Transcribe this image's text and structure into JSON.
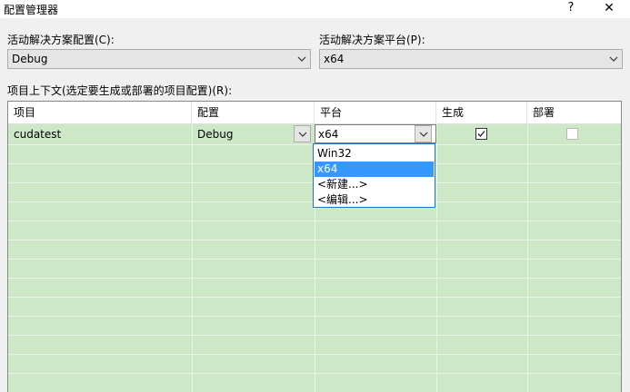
{
  "window": {
    "title": "配置管理器",
    "help_label": "?",
    "close_label": "✕"
  },
  "solution_config": {
    "label": "活动解决方案配置(C):",
    "value": "Debug"
  },
  "solution_platform": {
    "label": "活动解决方案平台(P):",
    "value": "x64"
  },
  "project_contexts": {
    "label": "项目上下文(选定要生成或部署的项目配置)(R):",
    "columns": [
      "项目",
      "配置",
      "平台",
      "生成",
      "部署"
    ],
    "rows": [
      {
        "project": "cudatest",
        "configuration": "Debug",
        "platform": "x64",
        "build": true,
        "deploy": false
      }
    ]
  },
  "platform_dropdown": {
    "options": [
      "Win32",
      "x64",
      "<新建...>",
      "<编辑...>"
    ],
    "selected": "x64"
  }
}
